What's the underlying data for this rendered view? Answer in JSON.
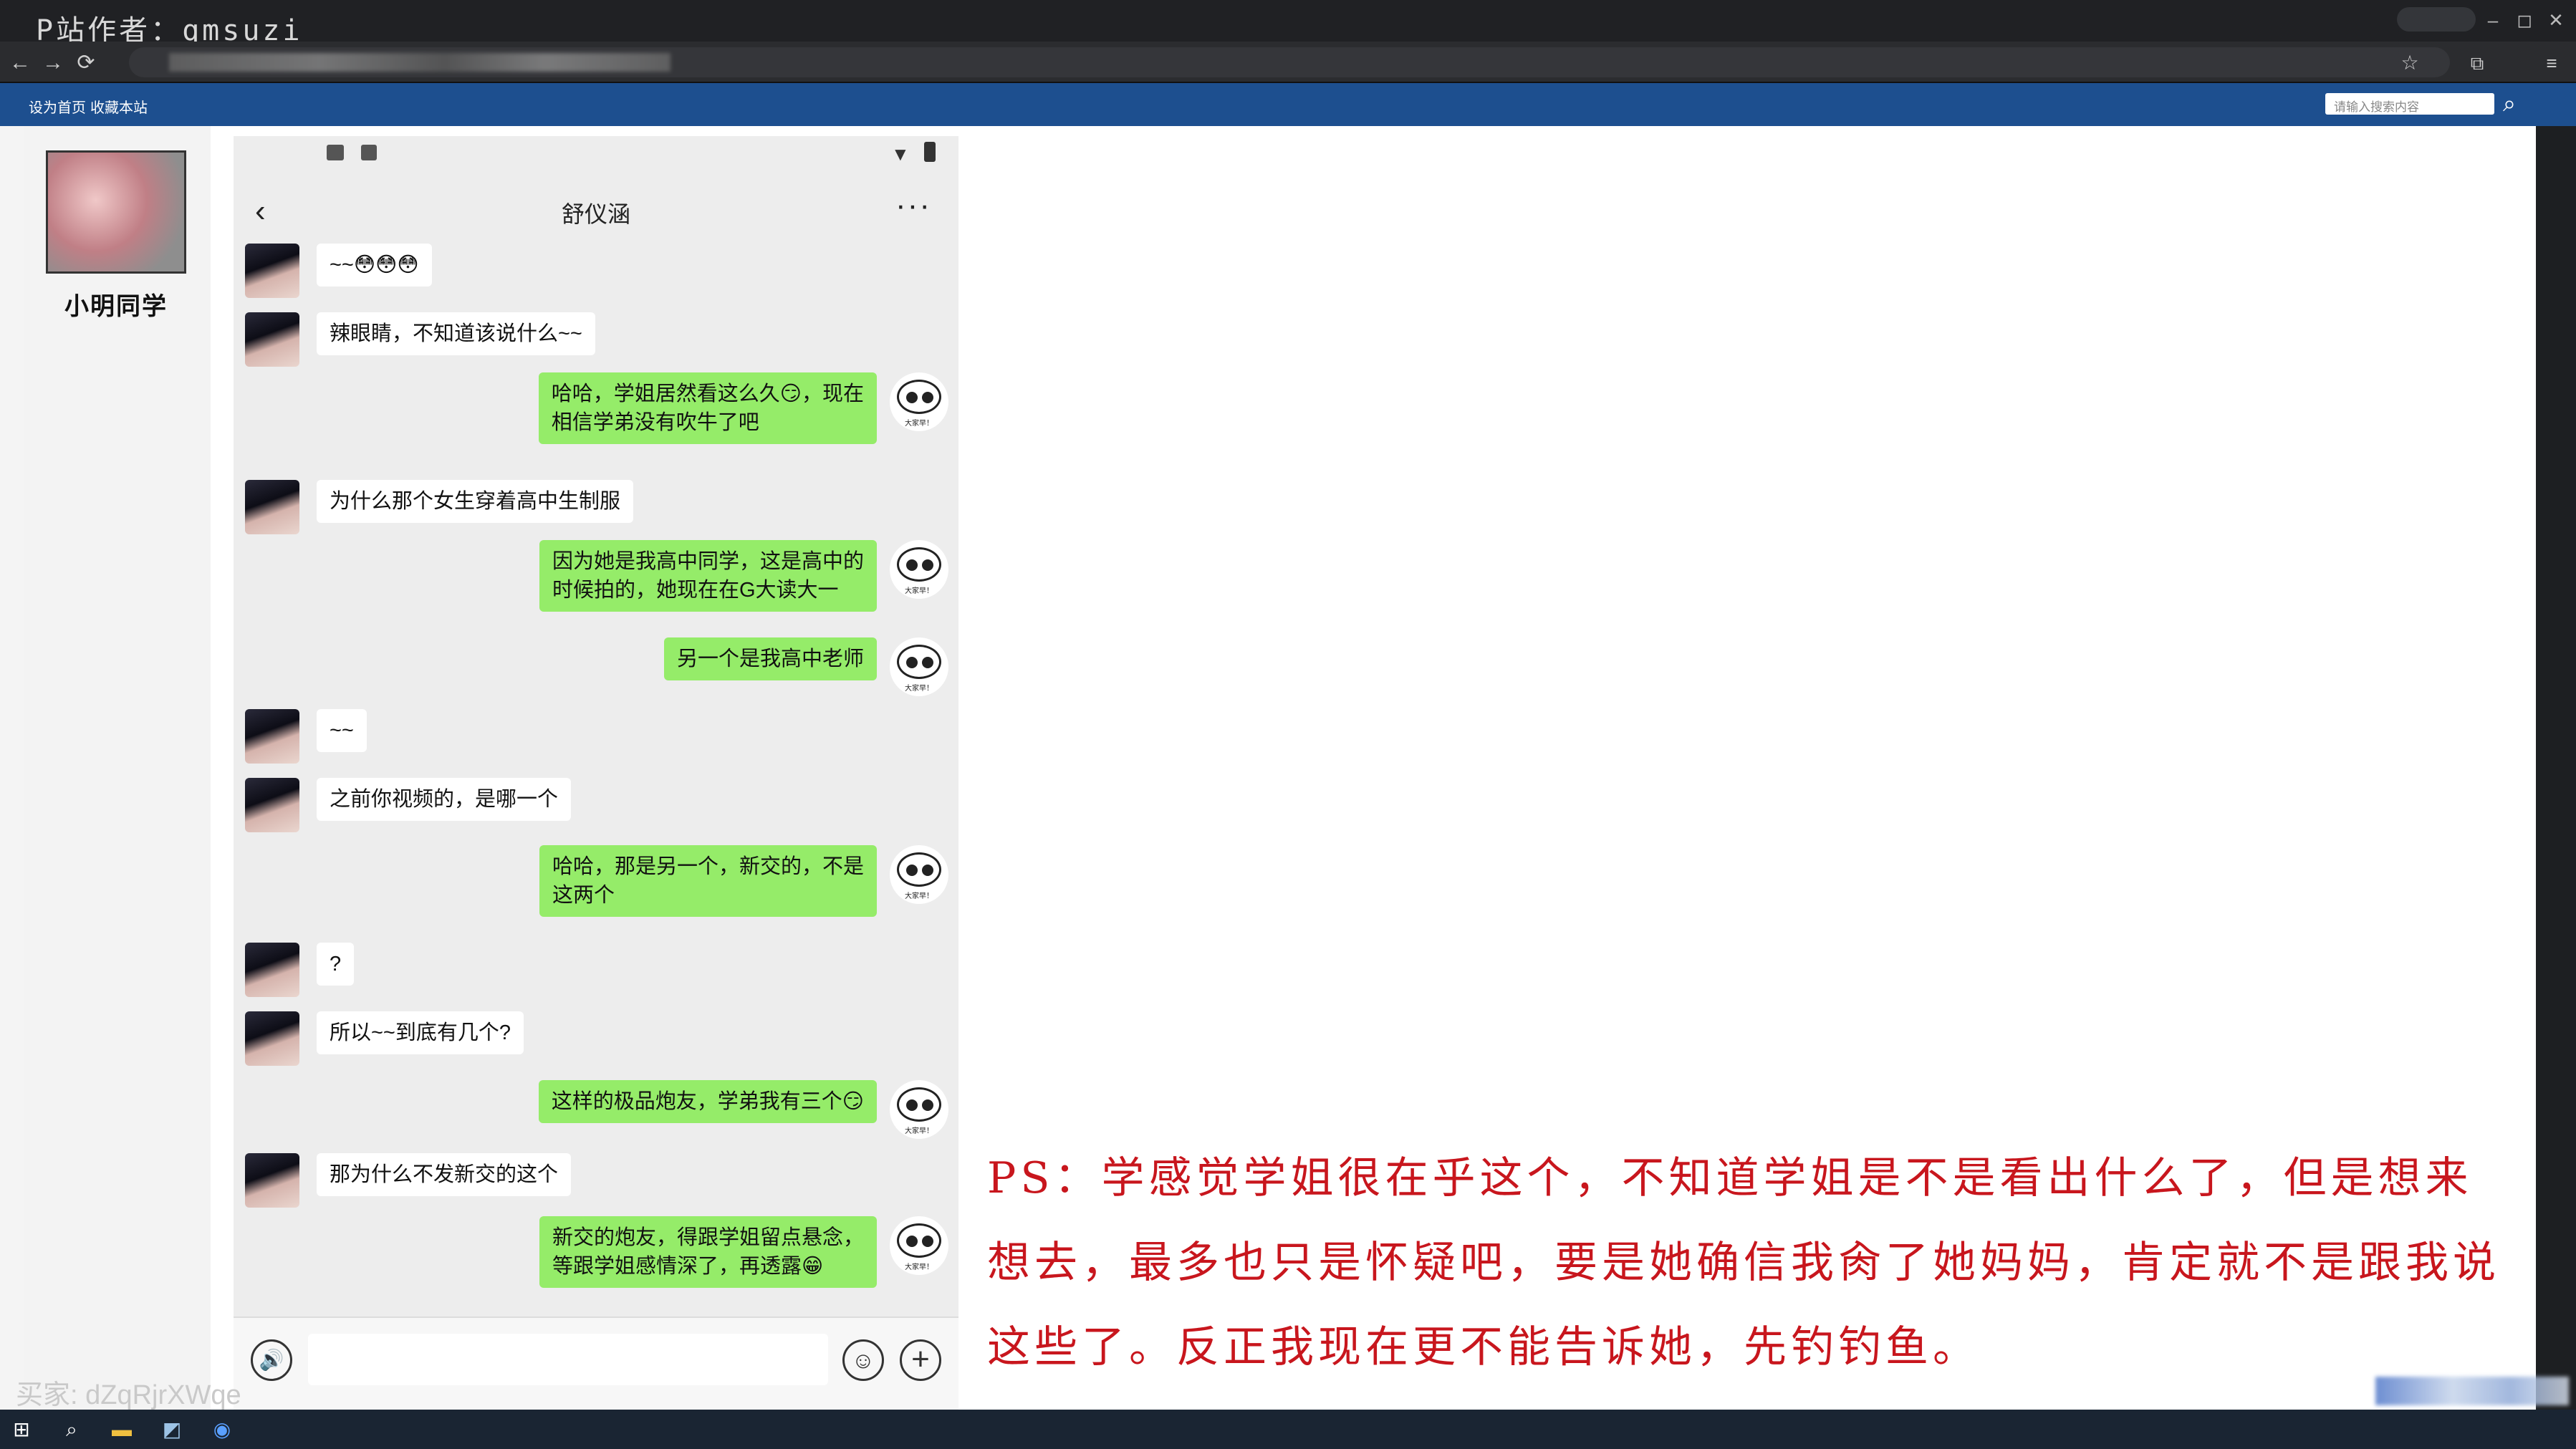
{
  "browser": {
    "watermark": "P站作者：qmsuzi",
    "nav": {
      "back": "←",
      "forward": "→",
      "reload": "⟳"
    },
    "window_controls": {
      "minimize": "–",
      "restore": "◻",
      "close": "✕"
    }
  },
  "site": {
    "links": [
      "设为首页",
      "收藏本站"
    ],
    "search_placeholder": "请输入搜索内容"
  },
  "sidebar": {
    "username": "小明同学"
  },
  "chat": {
    "contact_name": "舒仪涵",
    "header": {
      "back": "‹",
      "more": "···"
    },
    "messages": [
      {
        "from": "them",
        "text": "~~😳😳😳"
      },
      {
        "from": "them",
        "text": "辣眼睛，不知道该说什么~~"
      },
      {
        "from": "me",
        "text": "哈哈，学姐居然看这么久😏，现在\n相信学弟没有吹牛了吧"
      },
      {
        "from": "them",
        "text": "为什么那个女生穿着高中生制服"
      },
      {
        "from": "me",
        "text": "因为她是我高中同学，这是高中的\n时候拍的，她现在在G大读大一"
      },
      {
        "from": "me",
        "text": "另一个是我高中老师"
      },
      {
        "from": "them",
        "text": "~~"
      },
      {
        "from": "them",
        "text": "之前你视频的，是哪一个"
      },
      {
        "from": "me",
        "text": "哈哈，那是另一个，新交的，不是\n这两个"
      },
      {
        "from": "them",
        "text": "?"
      },
      {
        "from": "them",
        "text": "所以~~到底有几个?"
      },
      {
        "from": "me",
        "text": "这样的极品炮友，学弟我有三个😏"
      },
      {
        "from": "them",
        "text": "那为什么不发新交的这个"
      },
      {
        "from": "me",
        "text": "新交的炮友，得跟学姐留点悬念，\n等跟学姐感情深了，再透露😁"
      }
    ],
    "avatar_caption": "大家早！",
    "input": {
      "voice": "🔊",
      "emoji": "☺",
      "plus": "+"
    }
  },
  "note": {
    "text": "PS：学感觉学姐很在乎这个，不知道学姐是不是看出什么了，但是想来想去，最多也只是怀疑吧，要是她确信我肏了她妈妈，肯定就不是跟我说这些了。反正我现在更不能告诉她，先钓钓鱼。"
  },
  "overlay": {
    "buyer": "买家: dZqRjrXWqe"
  },
  "colors": {
    "site_bar": "#1d4f8f",
    "my_bubble": "#95ec69",
    "their_bubble": "#ffffff",
    "note_text": "#c8161d"
  }
}
